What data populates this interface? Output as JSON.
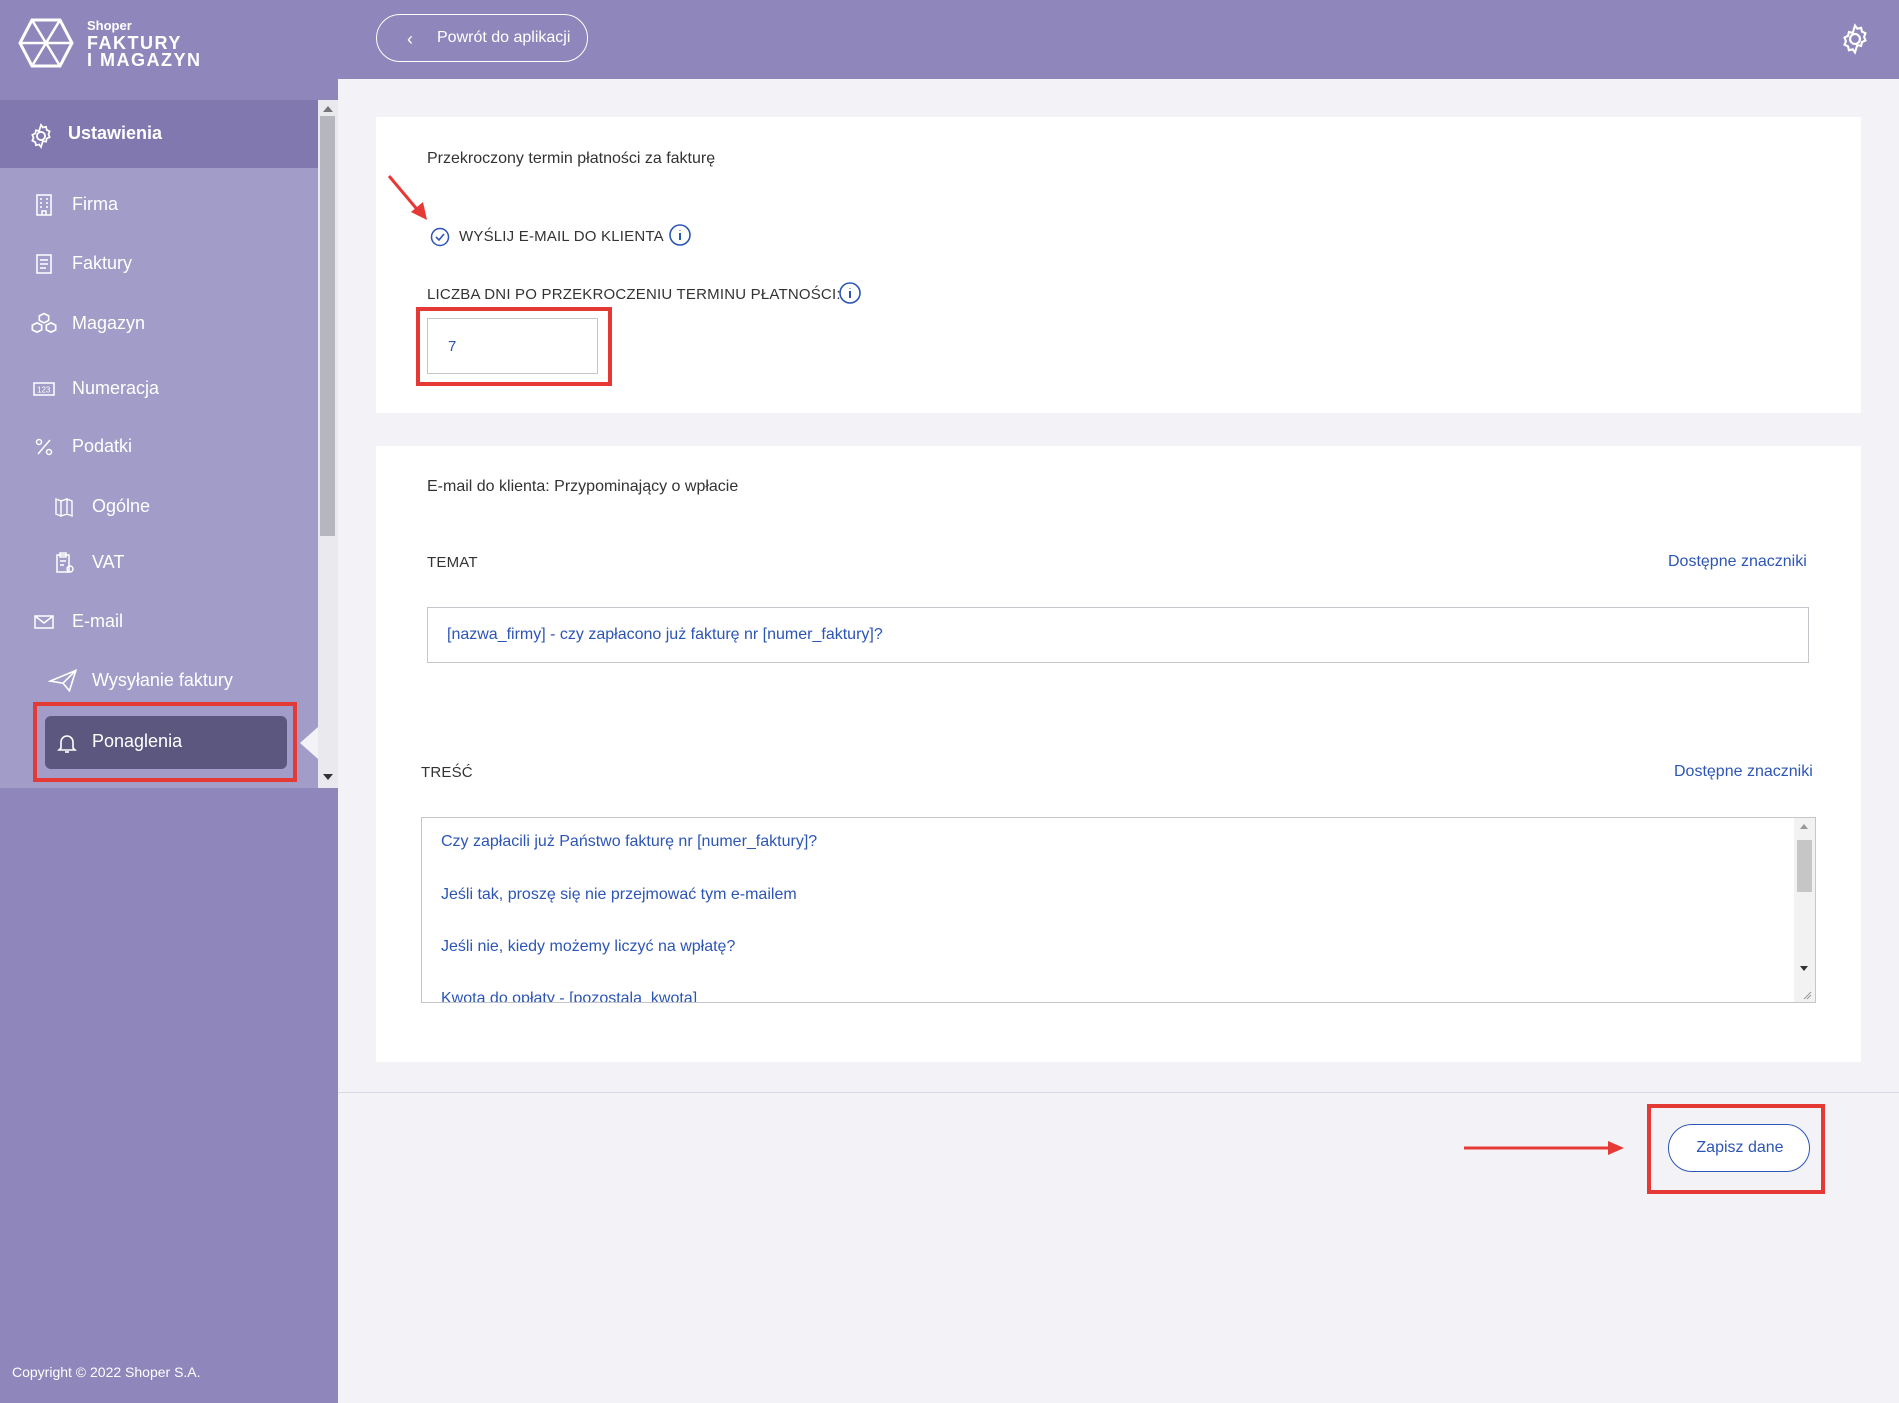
{
  "brand": {
    "small": "Shoper",
    "line1": "FAKTURY",
    "line2": "I MAGAZYN"
  },
  "sidebar": {
    "section_title": "Ustawienia",
    "items": [
      {
        "label": "Firma",
        "icon": "building-icon"
      },
      {
        "label": "Faktury",
        "icon": "document-icon"
      },
      {
        "label": "Magazyn",
        "icon": "boxes-icon"
      },
      {
        "label": "Numeracja",
        "icon": "numbering-icon"
      },
      {
        "label": "Podatki",
        "icon": "percent-icon"
      },
      {
        "label": "Ogólne",
        "icon": "book-icon"
      },
      {
        "label": "VAT",
        "icon": "clipboard-icon"
      },
      {
        "label": "E-mail",
        "icon": "envelope-icon"
      },
      {
        "label": "Wysyłanie faktury",
        "icon": "paper-plane-icon"
      }
    ],
    "active": {
      "label": "Ponaglenia",
      "icon": "bell-icon"
    },
    "copyright": "Copyright © 2022 Shoper S.A."
  },
  "topbar": {
    "back_label": "Powrót do aplikacji"
  },
  "overdue": {
    "title": "Przekroczony termin płatności za fakturę",
    "checkbox_label": "WYŚLIJ E-MAIL DO KLIENTA",
    "checkbox_checked": true,
    "days_label": "LICZBA DNI PO PRZEKROCZENIU TERMINU PŁATNOŚCI:",
    "days_value": "7"
  },
  "email": {
    "title": "E-mail do klienta: Przypominający o wpłacie",
    "subject_label": "TEMAT",
    "subject_tags_link": "Dostępne znaczniki",
    "subject_value": "[nazwa_firmy] - czy zapłacono już fakturę nr [numer_faktury]?",
    "body_label": "TREŚĆ",
    "body_tags_link": "Dostępne znaczniki",
    "body_lines": [
      "Czy zapłacili już Państwo fakturę nr [numer_faktury]?",
      "Jeśli tak, proszę się nie przejmować tym e-mailem",
      "Jeśli nie, kiedy możemy liczyć na wpłatę?",
      "Kwota do opłaty - [pozostala_kwota]"
    ]
  },
  "actions": {
    "save_label": "Zapisz dane"
  },
  "colors": {
    "sidebar": "#8f87bb",
    "active": "#5c577f",
    "link": "#2c55b5",
    "annotation": "#e53935"
  }
}
